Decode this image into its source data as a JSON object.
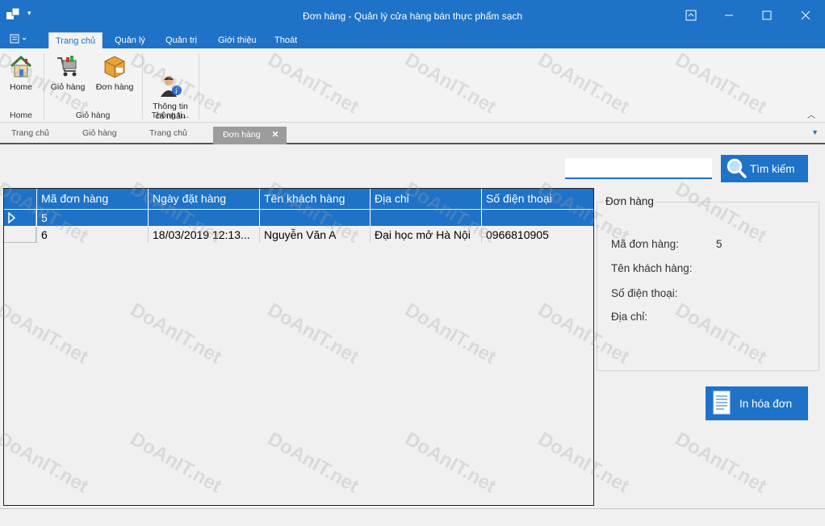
{
  "window": {
    "title": "Đơn hàng - Quản lý cửa hàng bán thực phẩm sạch"
  },
  "ribbon": {
    "tabs": [
      "Trang chủ",
      "Quản lý",
      "Quản trị",
      "Giới thiệu",
      "Thoát"
    ],
    "buttons": {
      "home": "Home",
      "cart": "Giỏ hàng",
      "orders": "Đơn hàng",
      "profile": "Thông tin\ncá nhân"
    },
    "groups": {
      "home": "Home",
      "cart": "Giỏ hàng",
      "info": "Thông ti..."
    }
  },
  "doc_tabs": [
    "Trang chủ",
    "Giỏ hàng",
    "Trang chủ",
    "Đơn hàng"
  ],
  "search": {
    "placeholder": "",
    "button_label": "Tìm kiếm"
  },
  "grid": {
    "columns": [
      "Mã đơn hàng",
      "Ngày đặt hàng",
      "Tên khách hàng",
      "Địa chỉ",
      "Số điện thoại"
    ],
    "rows": [
      [
        "5",
        "",
        "",
        "",
        ""
      ],
      [
        "6",
        "18/03/2019 12:13...",
        "Nguyễn Văn A",
        "Đại học mở Hà Nội",
        "0966810905"
      ]
    ]
  },
  "details": {
    "title": "Đơn hàng",
    "order_id_label": "Mã đơn hàng:",
    "order_id_value": "5",
    "customer_label": "Tên khách hàng:",
    "customer_value": "",
    "phone_label": "Số điện thoại:",
    "phone_value": "",
    "address_label": "Địa chỉ:",
    "address_value": ""
  },
  "print_button_label": "In hóa đơn",
  "watermark": "DoAnIT.net",
  "colors": {
    "accent": "#1e72c8",
    "background": "#f0f0f0"
  }
}
